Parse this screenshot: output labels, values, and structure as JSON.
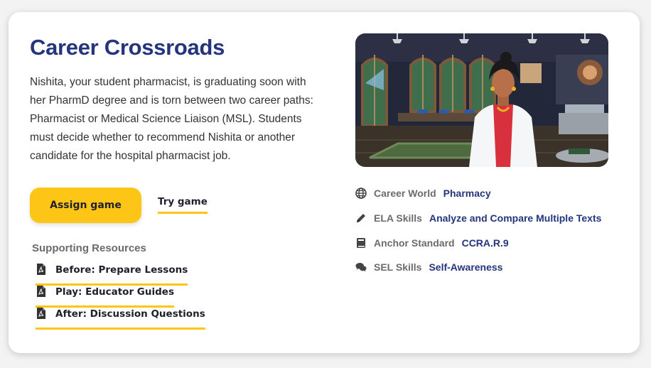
{
  "game": {
    "title": "Career Crossroads",
    "description": "Nishita, your student pharmacist, is graduating soon with her PharmD degree and is torn between two career paths: Pharmacist or Medical Science Liaison (MSL). Students must decide whether to recommend Nishita or another candidate for the hospital pharmacist job."
  },
  "actions": {
    "assign_label": "Assign game",
    "try_label": "Try game"
  },
  "resources": {
    "heading": "Supporting Resources",
    "items": [
      {
        "label": "Before: Prepare Lessons",
        "icon": "pdf-icon"
      },
      {
        "label": "Play: Educator Guides",
        "icon": "pdf-icon"
      },
      {
        "label": "After: Discussion Questions",
        "icon": "pdf-icon"
      }
    ]
  },
  "meta": [
    {
      "key": "Career World",
      "value": "Pharmacy",
      "icon": "globe-icon"
    },
    {
      "key": "ELA Skills",
      "value": "Analyze and Compare Multiple Texts",
      "icon": "pencil-icon"
    },
    {
      "key": "Anchor Standard",
      "value": "CCRA.R.9",
      "icon": "book-icon"
    },
    {
      "key": "SEL Skills",
      "value": "Self-Awareness",
      "icon": "chat-icon"
    }
  ],
  "colors": {
    "title": "#24357d",
    "accent": "#fdc616",
    "meta_value": "#24357d"
  }
}
